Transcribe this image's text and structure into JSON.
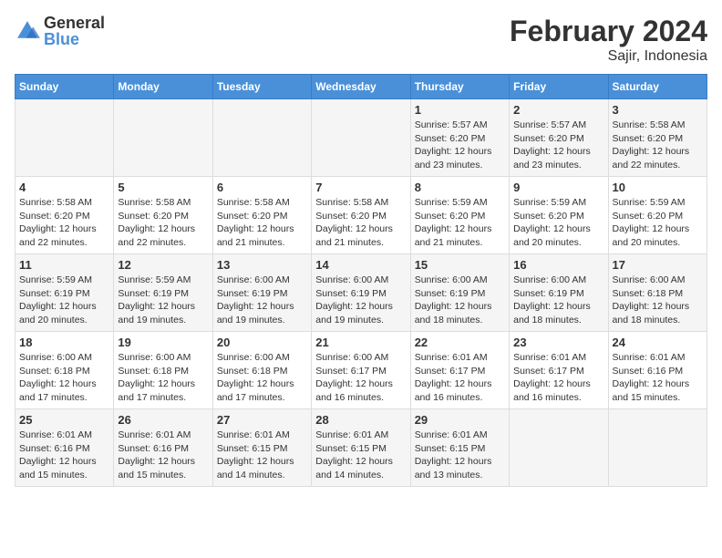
{
  "header": {
    "logo_line1": "General",
    "logo_line2": "Blue",
    "title": "February 2024",
    "subtitle": "Sajir, Indonesia"
  },
  "weekdays": [
    "Sunday",
    "Monday",
    "Tuesday",
    "Wednesday",
    "Thursday",
    "Friday",
    "Saturday"
  ],
  "rows": [
    [
      {
        "day": "",
        "sunrise": "",
        "sunset": "",
        "daylight": ""
      },
      {
        "day": "",
        "sunrise": "",
        "sunset": "",
        "daylight": ""
      },
      {
        "day": "",
        "sunrise": "",
        "sunset": "",
        "daylight": ""
      },
      {
        "day": "",
        "sunrise": "",
        "sunset": "",
        "daylight": ""
      },
      {
        "day": "1",
        "sunrise": "5:57 AM",
        "sunset": "6:20 PM",
        "daylight": "12 hours and 23 minutes."
      },
      {
        "day": "2",
        "sunrise": "5:57 AM",
        "sunset": "6:20 PM",
        "daylight": "12 hours and 23 minutes."
      },
      {
        "day": "3",
        "sunrise": "5:58 AM",
        "sunset": "6:20 PM",
        "daylight": "12 hours and 22 minutes."
      }
    ],
    [
      {
        "day": "4",
        "sunrise": "5:58 AM",
        "sunset": "6:20 PM",
        "daylight": "12 hours and 22 minutes."
      },
      {
        "day": "5",
        "sunrise": "5:58 AM",
        "sunset": "6:20 PM",
        "daylight": "12 hours and 22 minutes."
      },
      {
        "day": "6",
        "sunrise": "5:58 AM",
        "sunset": "6:20 PM",
        "daylight": "12 hours and 21 minutes."
      },
      {
        "day": "7",
        "sunrise": "5:58 AM",
        "sunset": "6:20 PM",
        "daylight": "12 hours and 21 minutes."
      },
      {
        "day": "8",
        "sunrise": "5:59 AM",
        "sunset": "6:20 PM",
        "daylight": "12 hours and 21 minutes."
      },
      {
        "day": "9",
        "sunrise": "5:59 AM",
        "sunset": "6:20 PM",
        "daylight": "12 hours and 20 minutes."
      },
      {
        "day": "10",
        "sunrise": "5:59 AM",
        "sunset": "6:20 PM",
        "daylight": "12 hours and 20 minutes."
      }
    ],
    [
      {
        "day": "11",
        "sunrise": "5:59 AM",
        "sunset": "6:19 PM",
        "daylight": "12 hours and 20 minutes."
      },
      {
        "day": "12",
        "sunrise": "5:59 AM",
        "sunset": "6:19 PM",
        "daylight": "12 hours and 19 minutes."
      },
      {
        "day": "13",
        "sunrise": "6:00 AM",
        "sunset": "6:19 PM",
        "daylight": "12 hours and 19 minutes."
      },
      {
        "day": "14",
        "sunrise": "6:00 AM",
        "sunset": "6:19 PM",
        "daylight": "12 hours and 19 minutes."
      },
      {
        "day": "15",
        "sunrise": "6:00 AM",
        "sunset": "6:19 PM",
        "daylight": "12 hours and 18 minutes."
      },
      {
        "day": "16",
        "sunrise": "6:00 AM",
        "sunset": "6:19 PM",
        "daylight": "12 hours and 18 minutes."
      },
      {
        "day": "17",
        "sunrise": "6:00 AM",
        "sunset": "6:18 PM",
        "daylight": "12 hours and 18 minutes."
      }
    ],
    [
      {
        "day": "18",
        "sunrise": "6:00 AM",
        "sunset": "6:18 PM",
        "daylight": "12 hours and 17 minutes."
      },
      {
        "day": "19",
        "sunrise": "6:00 AM",
        "sunset": "6:18 PM",
        "daylight": "12 hours and 17 minutes."
      },
      {
        "day": "20",
        "sunrise": "6:00 AM",
        "sunset": "6:18 PM",
        "daylight": "12 hours and 17 minutes."
      },
      {
        "day": "21",
        "sunrise": "6:00 AM",
        "sunset": "6:17 PM",
        "daylight": "12 hours and 16 minutes."
      },
      {
        "day": "22",
        "sunrise": "6:01 AM",
        "sunset": "6:17 PM",
        "daylight": "12 hours and 16 minutes."
      },
      {
        "day": "23",
        "sunrise": "6:01 AM",
        "sunset": "6:17 PM",
        "daylight": "12 hours and 16 minutes."
      },
      {
        "day": "24",
        "sunrise": "6:01 AM",
        "sunset": "6:16 PM",
        "daylight": "12 hours and 15 minutes."
      }
    ],
    [
      {
        "day": "25",
        "sunrise": "6:01 AM",
        "sunset": "6:16 PM",
        "daylight": "12 hours and 15 minutes."
      },
      {
        "day": "26",
        "sunrise": "6:01 AM",
        "sunset": "6:16 PM",
        "daylight": "12 hours and 15 minutes."
      },
      {
        "day": "27",
        "sunrise": "6:01 AM",
        "sunset": "6:15 PM",
        "daylight": "12 hours and 14 minutes."
      },
      {
        "day": "28",
        "sunrise": "6:01 AM",
        "sunset": "6:15 PM",
        "daylight": "12 hours and 14 minutes."
      },
      {
        "day": "29",
        "sunrise": "6:01 AM",
        "sunset": "6:15 PM",
        "daylight": "12 hours and 13 minutes."
      },
      {
        "day": "",
        "sunrise": "",
        "sunset": "",
        "daylight": ""
      },
      {
        "day": "",
        "sunrise": "",
        "sunset": "",
        "daylight": ""
      }
    ]
  ]
}
